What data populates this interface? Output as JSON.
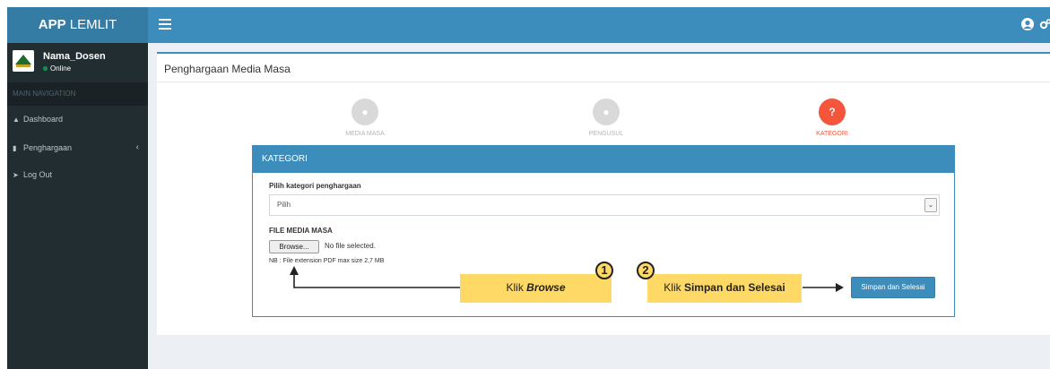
{
  "app": {
    "logo_bold": "APP",
    "logo_light": "LEMLIT"
  },
  "user": {
    "name": "Nama_Dosen",
    "status": "Online"
  },
  "sidebar": {
    "header": "MAIN NAVIGATION",
    "items": [
      {
        "label": "Dashboard",
        "icon": "home-icon"
      },
      {
        "label": "Penghargaan",
        "icon": "book-icon"
      },
      {
        "label": "Log Out",
        "icon": "sign-out-icon"
      }
    ]
  },
  "page": {
    "title": "Penghargaan Media Masa"
  },
  "steps": [
    {
      "label": "MEDIA MASA",
      "glyph": ""
    },
    {
      "label": "PENGUSUL",
      "glyph": ""
    },
    {
      "label": "KATEGORI",
      "glyph": "?"
    }
  ],
  "panel": {
    "heading": "KATEGORI",
    "category_label": "Pilih kategori penghargaan",
    "category_value": "Pilih",
    "file_label": "FILE MEDIA MASA",
    "browse_label": "Browse...",
    "no_file_text": "No file selected.",
    "note": "NB : File extension PDF max size 2,7 MB",
    "save_label": "Simpan dan Selesai"
  },
  "callouts": {
    "one": {
      "number": "1",
      "prefix": "Klik ",
      "emphasis": "Browse"
    },
    "two": {
      "number": "2",
      "prefix": "Klik ",
      "emphasis": "Simpan dan Selesai"
    }
  },
  "colors": {
    "topbar": "#3c8dbc",
    "logo_bg": "#357ca5",
    "sidebar": "#222d32",
    "active_step": "#f4553b",
    "callout": "#ffd966"
  }
}
